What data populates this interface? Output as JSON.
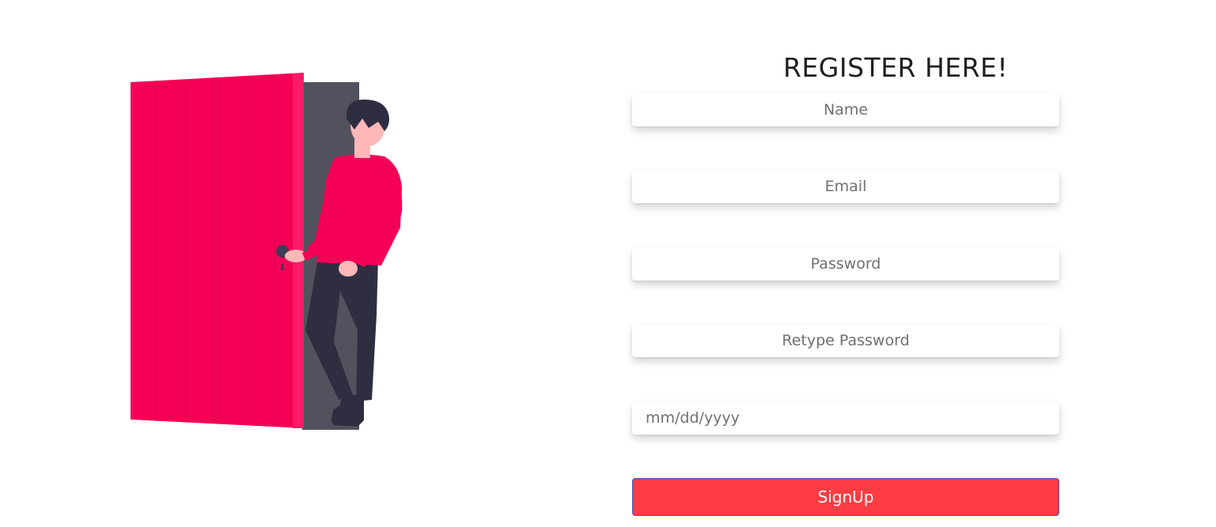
{
  "form": {
    "title": "REGISTER HERE!",
    "name_placeholder": "Name",
    "email_placeholder": "Email",
    "password_placeholder": "Password",
    "retype_password_placeholder": "Retype Password",
    "date_placeholder": "mm/dd/yyyy",
    "signup_label": "SignUp"
  },
  "colors": {
    "accent": "#ff3b43",
    "door": "#f50057",
    "door_frame": "#52525e",
    "person_shirt": "#f50057",
    "person_pants": "#2f2e41",
    "person_skin": "#ffb8b8"
  }
}
